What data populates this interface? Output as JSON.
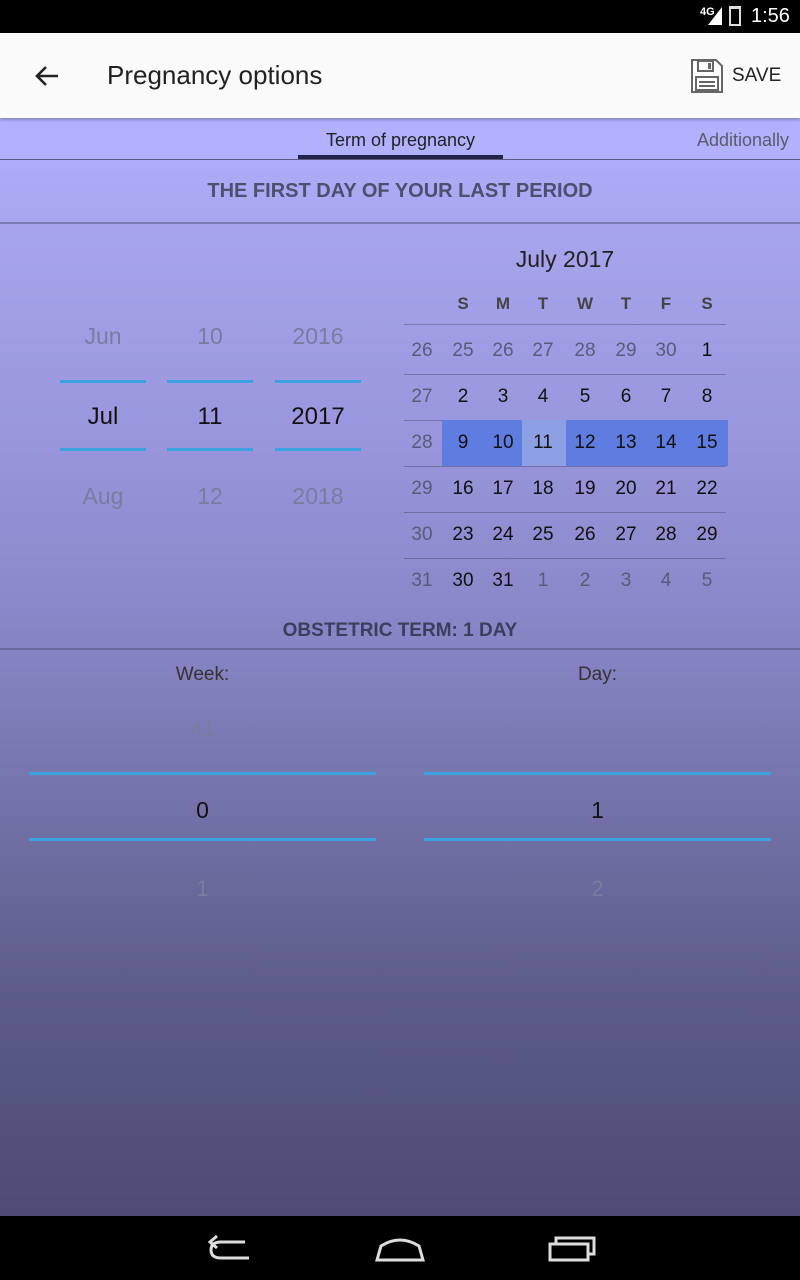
{
  "status_bar": {
    "network": "4G",
    "time": "1:56"
  },
  "app_bar": {
    "title": "Pregnancy options",
    "save_label": "SAVE"
  },
  "tabs": [
    {
      "label": "Term of pregnancy",
      "active": true
    },
    {
      "label": "Additionally",
      "active": false
    }
  ],
  "section_title": "THE FIRST DAY OF YOUR LAST PERIOD",
  "date_picker": {
    "month": {
      "prev": "Jun",
      "selected": "Jul",
      "next": "Aug"
    },
    "day": {
      "prev": "10",
      "selected": "11",
      "next": "12"
    },
    "year": {
      "prev": "2016",
      "selected": "2017",
      "next": "2018"
    }
  },
  "calendar": {
    "title": "July 2017",
    "weekdays": [
      "S",
      "M",
      "T",
      "W",
      "T",
      "F",
      "S"
    ],
    "weeks": [
      {
        "number": "26",
        "days": [
          "25",
          "26",
          "27",
          "28",
          "29",
          "30",
          "1"
        ]
      },
      {
        "number": "27",
        "days": [
          "2",
          "3",
          "4",
          "5",
          "6",
          "7",
          "8"
        ]
      },
      {
        "number": "28",
        "days": [
          "9",
          "10",
          "11",
          "12",
          "13",
          "14",
          "15"
        ]
      },
      {
        "number": "29",
        "days": [
          "16",
          "17",
          "18",
          "19",
          "20",
          "21",
          "22"
        ]
      },
      {
        "number": "30",
        "days": [
          "23",
          "24",
          "25",
          "26",
          "27",
          "28",
          "29"
        ]
      },
      {
        "number": "31",
        "days": [
          "30",
          "31",
          "1",
          "2",
          "3",
          "4",
          "5"
        ]
      }
    ],
    "selected_day": "11",
    "highlighted_week": "28"
  },
  "obstetric_term": "OBSTETRIC TERM:  1 DAY",
  "week_picker": {
    "label": "Week:",
    "prev": "41",
    "selected": "0",
    "next": "1"
  },
  "day_picker": {
    "label": "Day:",
    "prev": "-",
    "selected": "1",
    "next": "2"
  },
  "colors": {
    "accent": "#3aa3df",
    "highlight": "#5f7de0",
    "tab_bg": "#b1b1fe"
  }
}
